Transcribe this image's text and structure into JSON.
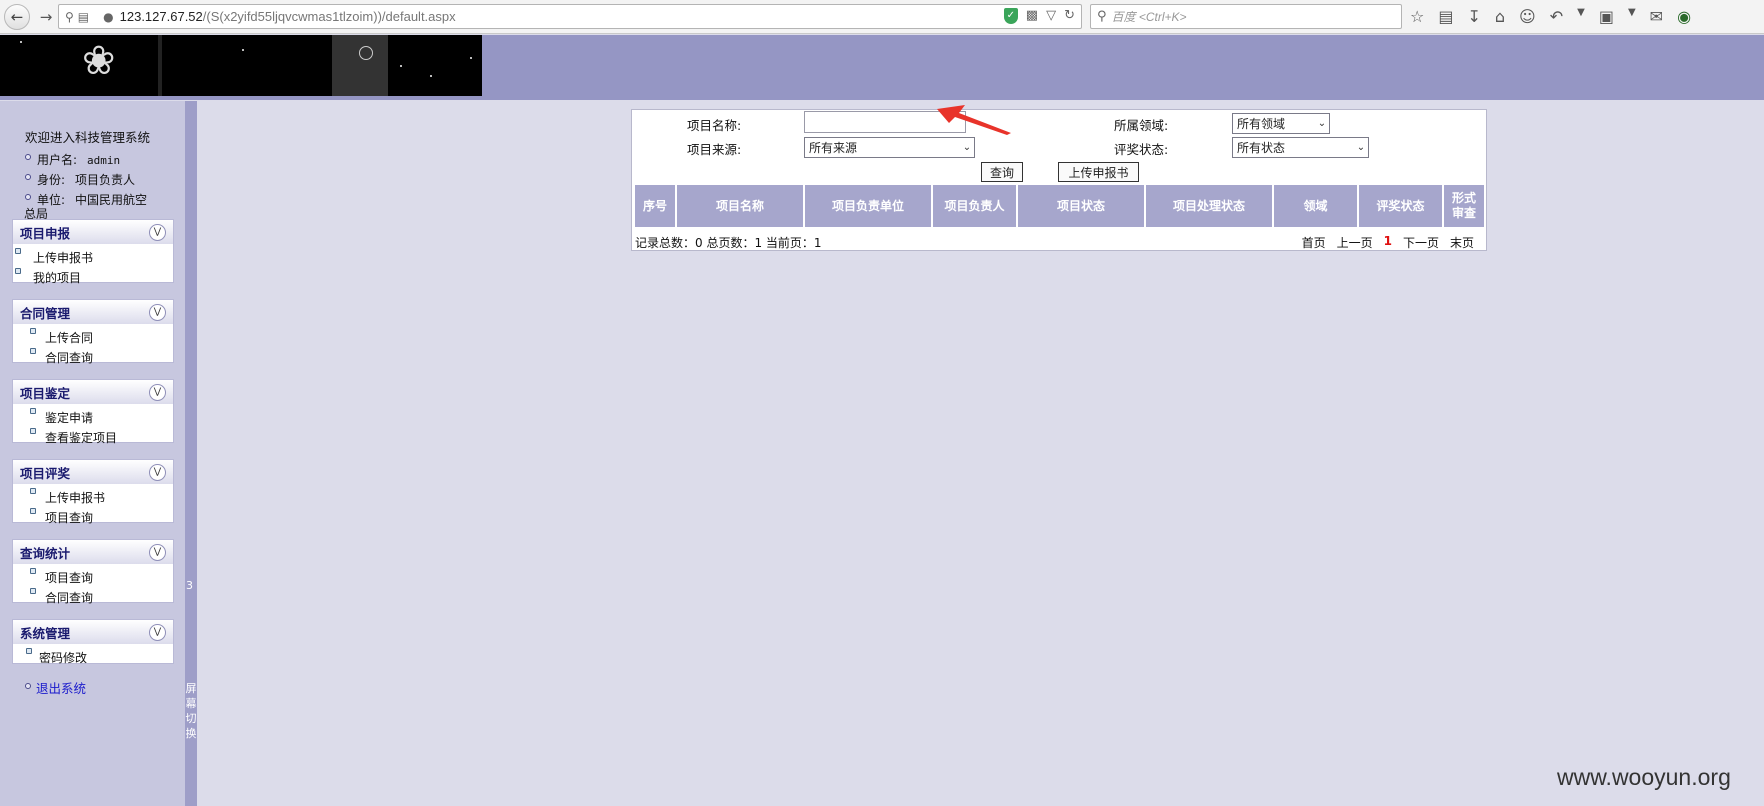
{
  "browser": {
    "url_main": "123.127.67.52",
    "url_rest": "/(S(x2yifd55ljqvcwmas1tlzoim))/default.aspx",
    "search_placeholder": "百度 <Ctrl+K>"
  },
  "sidebar": {
    "welcome": "欢迎进入科技管理系统",
    "user_label": "用户名:",
    "user_value": "admin",
    "role_label": "身份:",
    "role_value": "项目负责人",
    "unit_label": "单位:",
    "unit_value": "中国民用航空",
    "unit_value_wrap": "总局",
    "panels": [
      {
        "title": "项目申报",
        "items": [
          "上传申报书",
          "我的项目"
        ]
      },
      {
        "title": "合同管理",
        "items": [
          "上传合同",
          "合同查询"
        ]
      },
      {
        "title": "项目鉴定",
        "items": [
          "鉴定申请",
          "查看鉴定项目"
        ]
      },
      {
        "title": "项目评奖",
        "items": [
          "上传申报书",
          "项目查询"
        ]
      },
      {
        "title": "查询统计",
        "items": [
          "项目查询",
          "合同查询"
        ]
      },
      {
        "title": "系统管理",
        "items": [
          "密码修改"
        ]
      }
    ],
    "logout": "退出系统",
    "divider_number": "3",
    "screen_toggle": "屏幕切换"
  },
  "search_form": {
    "name_label": "项目名称:",
    "name_value": "",
    "field_label": "所属领域:",
    "field_value": "所有领域",
    "source_label": "项目来源:",
    "source_value": "所有来源",
    "award_label": "评奖状态:",
    "award_value": "所有状态",
    "query_button": "查询",
    "upload_button": "上传申报书"
  },
  "table": {
    "columns": [
      "序号",
      "项目名称",
      "项目负责单位",
      "项目负责人",
      "项目状态",
      "项目处理状态",
      "领域",
      "评奖状态",
      "形式审查"
    ]
  },
  "pagination": {
    "stats": "记录总数：0 总页数：1 当前页：1",
    "first": "首页",
    "prev": "上一页",
    "current": "1",
    "next": "下一页",
    "last": "末页"
  },
  "watermark": "www.wooyun.org",
  "colors": {
    "header_bg": "#9596c4",
    "sidebar_bg": "#c7c7df",
    "content_bg": "#dcdcea",
    "table_header": "#a6a6cc",
    "arrow": "#e8332a"
  }
}
